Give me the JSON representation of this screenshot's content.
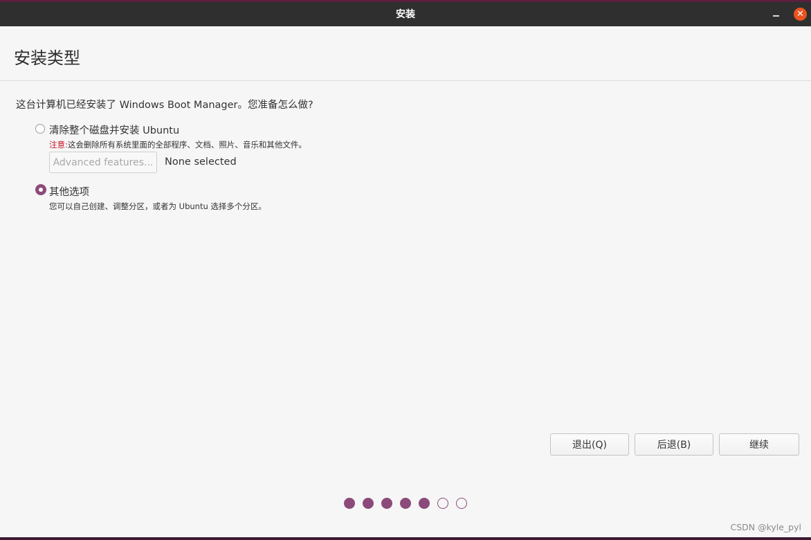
{
  "window": {
    "title": "安装",
    "minimize_icon": "minimize-icon",
    "close_icon": "close-icon",
    "close_glyph": "✕"
  },
  "page": {
    "title": "安装类型",
    "question": "这台计算机已经安装了 Windows Boot Manager。您准备怎么做?"
  },
  "options": [
    {
      "label": "清除整个磁盘并安装 Ubuntu",
      "selected": false,
      "warning_label": "注意:",
      "warning_text": "这会删除所有系统里面的全部程序、文档、照片、音乐和其他文件。",
      "advanced_button": "Advanced features...",
      "advanced_status": "None selected"
    },
    {
      "label": "其他选项",
      "selected": true,
      "description": "您可以自己创建、调整分区，或者为 Ubuntu 选择多个分区。"
    }
  ],
  "buttons": {
    "quit": "退出(Q)",
    "back": "后退(B)",
    "continue": "继续"
  },
  "progress": {
    "completed_steps": 5,
    "total_steps": 7
  },
  "colors": {
    "accent": "#8c4a7b",
    "warning": "#c7162b",
    "close": "#e95420",
    "titlebar": "#2f2f2f"
  },
  "watermark": "CSDN @kyle_pyl"
}
